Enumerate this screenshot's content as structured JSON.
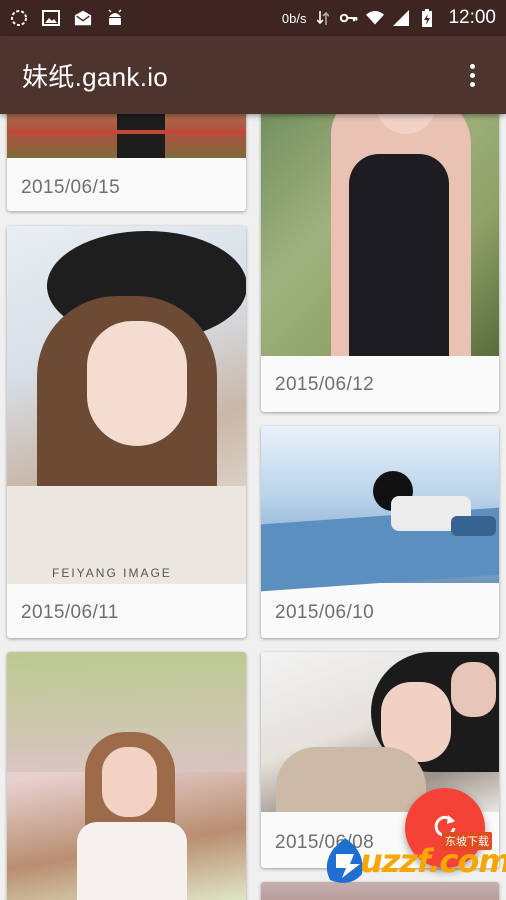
{
  "status_bar": {
    "net_speed": "0b/s",
    "time": "12:00",
    "colors": {
      "background": "#3d2521"
    }
  },
  "app_bar": {
    "title": "妹纸.gank.io",
    "colors": {
      "background": "#4e342e"
    }
  },
  "cards": [
    {
      "date": "2015/06/15",
      "photo": "photo-legs-on-track"
    },
    {
      "date": "2015/06/12",
      "photo": "photo-woman-black-swimsuit"
    },
    {
      "date": "2015/06/11",
      "photo": "photo-woman-black-hat"
    },
    {
      "date": "2015/06/10",
      "photo": "photo-woman-on-rooftop"
    },
    {
      "date": "",
      "photo": "photo-woman-in-garden"
    },
    {
      "date": "2015/06/08",
      "photo": "photo-woman-hand-on-head"
    },
    {
      "date": "",
      "photo": "photo-partial"
    }
  ],
  "fab": {
    "icon": "refresh-icon",
    "color": "#f44336"
  },
  "watermark": {
    "text": "uzzf.com",
    "subtitle": "东坡下载"
  }
}
